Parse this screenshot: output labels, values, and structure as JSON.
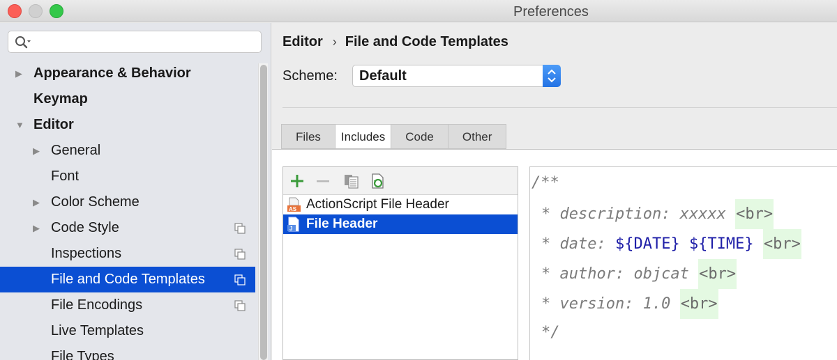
{
  "window": {
    "title": "Preferences"
  },
  "sidebar": {
    "search_placeholder": "",
    "items": [
      {
        "label": "Appearance & Behavior",
        "level": 0,
        "expandable": true,
        "expanded": false,
        "bold": true
      },
      {
        "label": "Keymap",
        "level": 0,
        "expandable": false,
        "bold": true
      },
      {
        "label": "Editor",
        "level": 0,
        "expandable": true,
        "expanded": true,
        "bold": true
      },
      {
        "label": "General",
        "level": 1,
        "expandable": true,
        "expanded": false
      },
      {
        "label": "Font",
        "level": 1,
        "expandable": false
      },
      {
        "label": "Color Scheme",
        "level": 1,
        "expandable": true,
        "expanded": false
      },
      {
        "label": "Code Style",
        "level": 1,
        "expandable": true,
        "expanded": false,
        "project_icon": true
      },
      {
        "label": "Inspections",
        "level": 1,
        "expandable": false,
        "project_icon": true
      },
      {
        "label": "File and Code Templates",
        "level": 1,
        "expandable": false,
        "project_icon": true,
        "selected": true
      },
      {
        "label": "File Encodings",
        "level": 1,
        "expandable": false,
        "project_icon": true
      },
      {
        "label": "Live Templates",
        "level": 1,
        "expandable": false
      },
      {
        "label": "File Types",
        "level": 1,
        "expandable": false
      }
    ]
  },
  "breadcrumb": {
    "parent": "Editor",
    "separator": "›",
    "current": "File and Code Templates"
  },
  "scheme": {
    "label": "Scheme:",
    "value": "Default"
  },
  "tabs": [
    {
      "label": "Files",
      "active": false
    },
    {
      "label": "Includes",
      "active": true
    },
    {
      "label": "Code",
      "active": false
    },
    {
      "label": "Other",
      "active": false
    }
  ],
  "toolbar": {
    "add_icon": "plus-icon",
    "remove_icon": "minus-icon",
    "copy_icon": "copy-icon",
    "reset_icon": "reset-icon"
  },
  "templates": [
    {
      "label": "ActionScript File Header",
      "icon": "actionscript-file-icon",
      "selected": false
    },
    {
      "label": "File Header",
      "icon": "java-file-icon",
      "selected": true
    }
  ],
  "code": {
    "open": "/**",
    "description_text": "* description: xxxxx ",
    "date_text": "* date: ",
    "date_macro": "${DATE}",
    "time_macro": "${TIME}",
    "author_text": "* author: objcat ",
    "version_text": "* version: 1.0 ",
    "br_tag": "<br>",
    "close": "*/"
  },
  "colors": {
    "selection": "#0b4fd3",
    "macro": "#1f1fa8",
    "br_highlight": "#e4f9e2"
  }
}
